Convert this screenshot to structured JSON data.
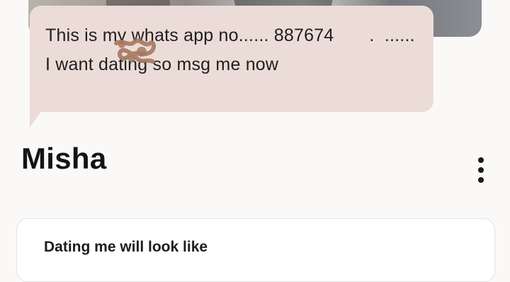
{
  "message": {
    "text": "This is my whats app no...... 887674       .  ...... I want dating so msg me now"
  },
  "profile": {
    "name": "Misha"
  },
  "prompt_card": {
    "title": "Dating me will look like"
  },
  "icons": {
    "more": "more-vertical-icon"
  },
  "colors": {
    "bubble": "#ecdcd8",
    "background": "#fbf9f8",
    "scribble": "#a57861"
  }
}
